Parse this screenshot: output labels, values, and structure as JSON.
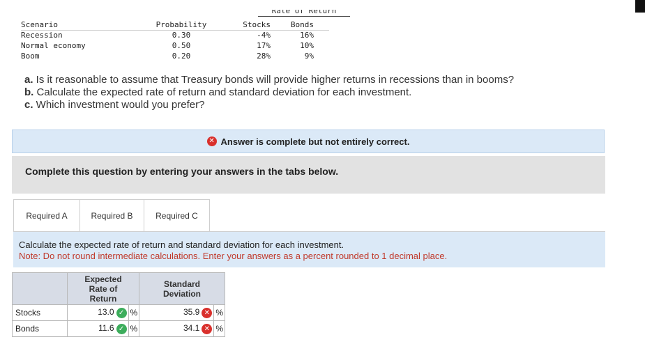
{
  "scenario_table": {
    "group_header": "Rate of Return",
    "headers": [
      "Scenario",
      "Probability",
      "Stocks",
      "Bonds"
    ],
    "rows": [
      [
        "Recession",
        "0.30",
        "-4%",
        "16%"
      ],
      [
        "Normal economy",
        "0.50",
        "17%",
        "10%"
      ],
      [
        "Boom",
        "0.20",
        "28%",
        "9%"
      ]
    ]
  },
  "questions": {
    "a_prefix": "a.",
    "a_text": " Is it reasonable to assume that Treasury bonds will provide higher returns in recessions than in booms?",
    "b_prefix": "b.",
    "b_text": " Calculate the expected rate of return and standard deviation for each investment.",
    "c_prefix": "c.",
    "c_text": " Which investment would you prefer?"
  },
  "answer_banner": {
    "text": "Answer is complete but not entirely correct."
  },
  "instruction": "Complete this question by entering your answers in the tabs below.",
  "tabs": [
    {
      "label": "Required A"
    },
    {
      "label": "Required B"
    },
    {
      "label": "Required C"
    }
  ],
  "task": {
    "line1": "Calculate the expected rate of return and standard deviation for each investment.",
    "line2": "Note: Do not round intermediate calculations. Enter your answers as a percent rounded to 1 decimal place."
  },
  "answer_table": {
    "headers": [
      "",
      "Expected Rate of Return",
      "Standard Deviation"
    ],
    "rows": [
      {
        "label": "Stocks",
        "expected": "13.0",
        "expected_status": "correct",
        "std": "35.9",
        "std_status": "incorrect",
        "unit": "%"
      },
      {
        "label": "Bonds",
        "expected": "11.6",
        "expected_status": "correct",
        "std": "34.1",
        "std_status": "incorrect",
        "unit": "%"
      }
    ]
  },
  "colors": {
    "correct": "#3dad5c",
    "incorrect": "#d9302c",
    "banner_bg": "#dbe9f7",
    "note_text": "#c0392b"
  },
  "icons": {
    "correct": "check-icon",
    "incorrect": "x-icon"
  }
}
